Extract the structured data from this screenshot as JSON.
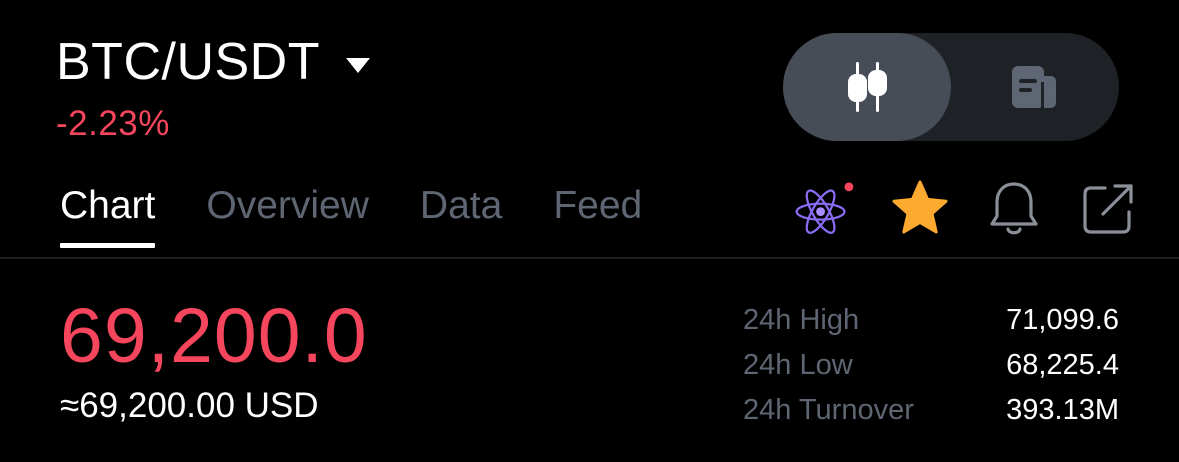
{
  "header": {
    "pair": "BTC/USDT",
    "change": "-2.23%"
  },
  "view_toggle": {
    "active_icon": "candlestick-icon",
    "inactive_icon": "document-icon"
  },
  "tabs": [
    {
      "label": "Chart",
      "active": true
    },
    {
      "label": "Overview",
      "active": false
    },
    {
      "label": "Data",
      "active": false
    },
    {
      "label": "Feed",
      "active": false
    }
  ],
  "tab_actions": [
    "atom-ai-icon",
    "star-icon",
    "bell-icon",
    "share-icon"
  ],
  "price": {
    "last": "69,200.0",
    "usd": "≈69,200.00 USD"
  },
  "stats": [
    {
      "label": "24h High",
      "value": "71,099.6"
    },
    {
      "label": "24h Low",
      "value": "68,225.4"
    },
    {
      "label": "24h Turnover",
      "value": "393.13M"
    }
  ],
  "colors": {
    "negative": "#f6465d",
    "muted": "#5e6673",
    "star": "#fcaa2f",
    "background": "#000000"
  }
}
